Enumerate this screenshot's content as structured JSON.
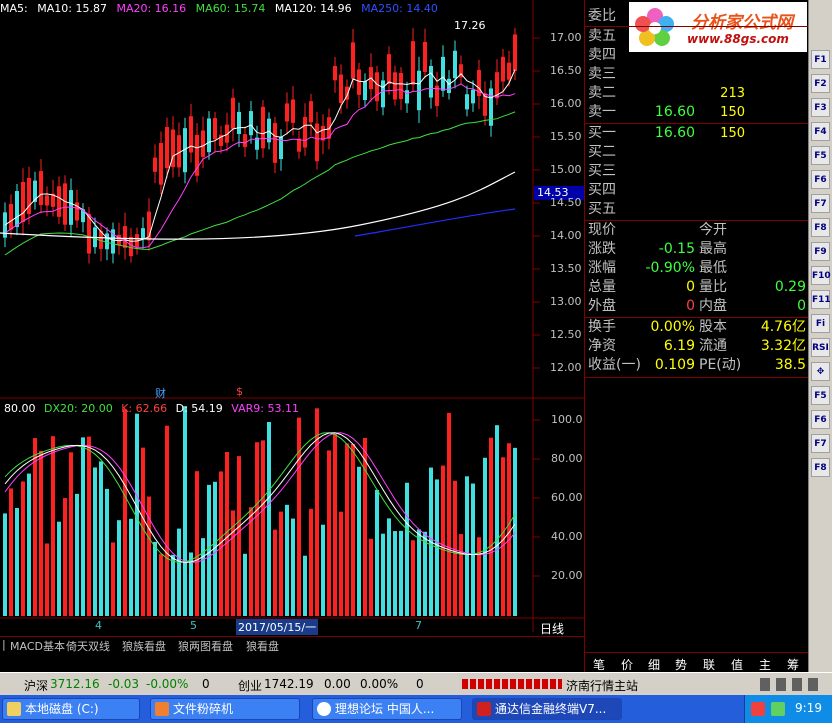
{
  "ma_bar": {
    "ma5": "MA5:",
    "ma10": "MA10: 15.87",
    "ma20": "MA20: 16.16",
    "ma60": "MA60: 15.74",
    "ma120": "MA120: 14.96",
    "ma250": "MA250: 14.40"
  },
  "high_label": "17.26",
  "price_tag": "14.53",
  "y_ticks": [
    "17.00",
    "16.50",
    "16.00",
    "15.50",
    "15.00",
    "14.50",
    "14.00",
    "13.50",
    "13.00",
    "12.50",
    "12.00"
  ],
  "event_markers": {
    "cai": "财",
    "dollar": "$"
  },
  "sub_bar": {
    "v1": "80.00",
    "dx20": "DX20: 20.00",
    "k": "K: 62.66",
    "d": "D: 54.19",
    "var9": "VAR9: 53.11"
  },
  "sub_y_ticks": [
    "100.0",
    "80.00",
    "60.00",
    "40.00",
    "20.00"
  ],
  "x_ticks": {
    "t4": "4",
    "t5": "5",
    "t7": "7",
    "date": "2017/05/15/一"
  },
  "period": "日线",
  "plus": "+",
  "minus": "-",
  "tabs": [
    "MACD基本",
    "倚天双线",
    "狼族看盘",
    "狼两图看盘",
    "狼看盘"
  ],
  "logo": {
    "title": "分析家公式网",
    "url": "www.88gs.com"
  },
  "quote": {
    "weibi": "委比",
    "sell5": "卖五",
    "sell4": "卖四",
    "sell3": "卖三",
    "sell2": "卖二",
    "sell1": "卖一",
    "sell2_vol": "213",
    "sell1_price": "16.60",
    "sell1_vol": "150",
    "buy1": "买一",
    "buy2": "买二",
    "buy3": "买三",
    "buy4": "买四",
    "buy5": "买五",
    "buy1_price": "16.60",
    "buy1_vol": "150",
    "xianjia": "现价",
    "jinkai": "今开",
    "zhangdie": "涨跌",
    "zhangdie_v": "-0.15",
    "zuigao": "最高",
    "zhangfu": "涨幅",
    "zhangfu_v": "-0.90%",
    "zuidi": "最低",
    "zongliang": "总量",
    "zongliang_v": "0",
    "liangbi": "量比",
    "liangbi_v": "0.29",
    "waipan": "外盘",
    "waipan_v": "0",
    "neipan": "内盘",
    "neipan_v": "0",
    "huanshou": "换手",
    "huanshou_v": "0.00%",
    "guben": "股本",
    "guben_v": "4.76亿",
    "jingzi": "净资",
    "jingzi_v": "6.19",
    "liutong": "流通",
    "liutong_v": "3.32亿",
    "shouyi": "收益(一)",
    "shouyi_v": "0.109",
    "pe": "PE(动)",
    "pe_v": "38.5"
  },
  "bottom_tabs": [
    "笔",
    "价",
    "细",
    "势",
    "联",
    "值",
    "主",
    "筹"
  ],
  "toolbar": [
    "F1",
    "F2",
    "F3",
    "F4",
    "F5",
    "F6",
    "F7",
    "F8",
    "F9",
    "F10",
    "F11",
    "Fi",
    "RSI",
    "✥",
    "F5",
    "F6",
    "F7",
    "F8"
  ],
  "status": {
    "hushen_label": "沪深",
    "hushen_v": "3712.16",
    "hushen_chg": "-0.03",
    "hushen_pct": "-0.00%",
    "hushen_vol": "0",
    "chuangye_label": "创业",
    "chuangye_v": "1742.19",
    "chuangye_chg": "0.00",
    "chuangye_pct": "0.00%",
    "chuangye_vol": "0",
    "station": "济南行情主站"
  },
  "taskbar": {
    "items": [
      "本地磁盘 (C:)",
      "文件粉碎机",
      "理想论坛 中国人...",
      "通达信金融终端V7..."
    ],
    "clock": "9:19"
  },
  "colors": {
    "up": "#ff2020",
    "down": "#40e0e0",
    "ma10": "#ffffff",
    "ma20": "#ff40ff",
    "ma60": "#40e040",
    "ma120": "#ffffff",
    "ma250": "#2030ff"
  }
}
